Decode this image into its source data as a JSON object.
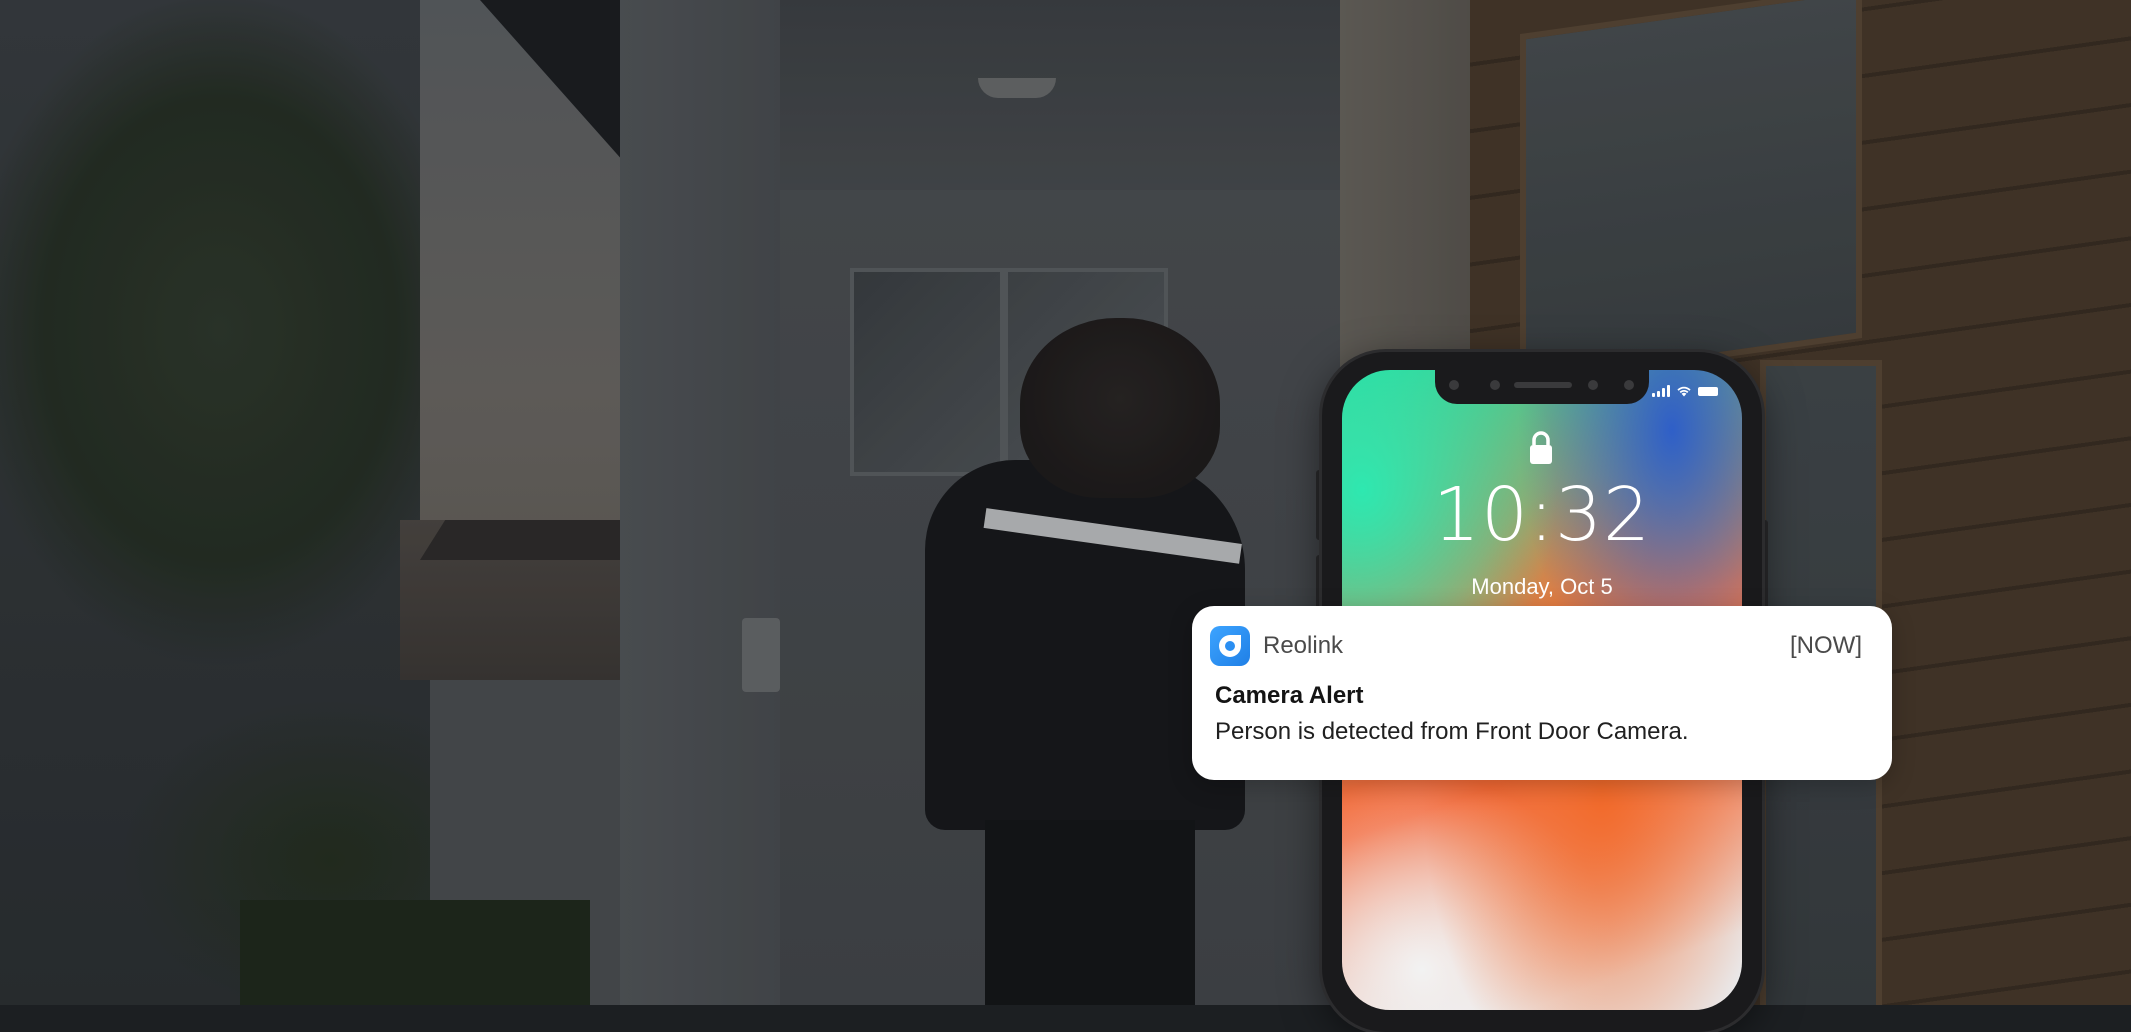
{
  "phone": {
    "time": "10:32",
    "date": "Monday, Oct 5"
  },
  "notification": {
    "app_name": "Reolink",
    "timestamp": "[NOW]",
    "title": "Camera Alert",
    "message": "Person is detected from Front Door Camera."
  },
  "colors": {
    "app_icon": "#1f7fe6",
    "card_background": "#ffffff"
  },
  "icons": {
    "app": "reolink-app-icon",
    "lock": "lock-icon",
    "signal": "signal-icon",
    "wifi": "wifi-icon",
    "battery": "battery-icon"
  }
}
